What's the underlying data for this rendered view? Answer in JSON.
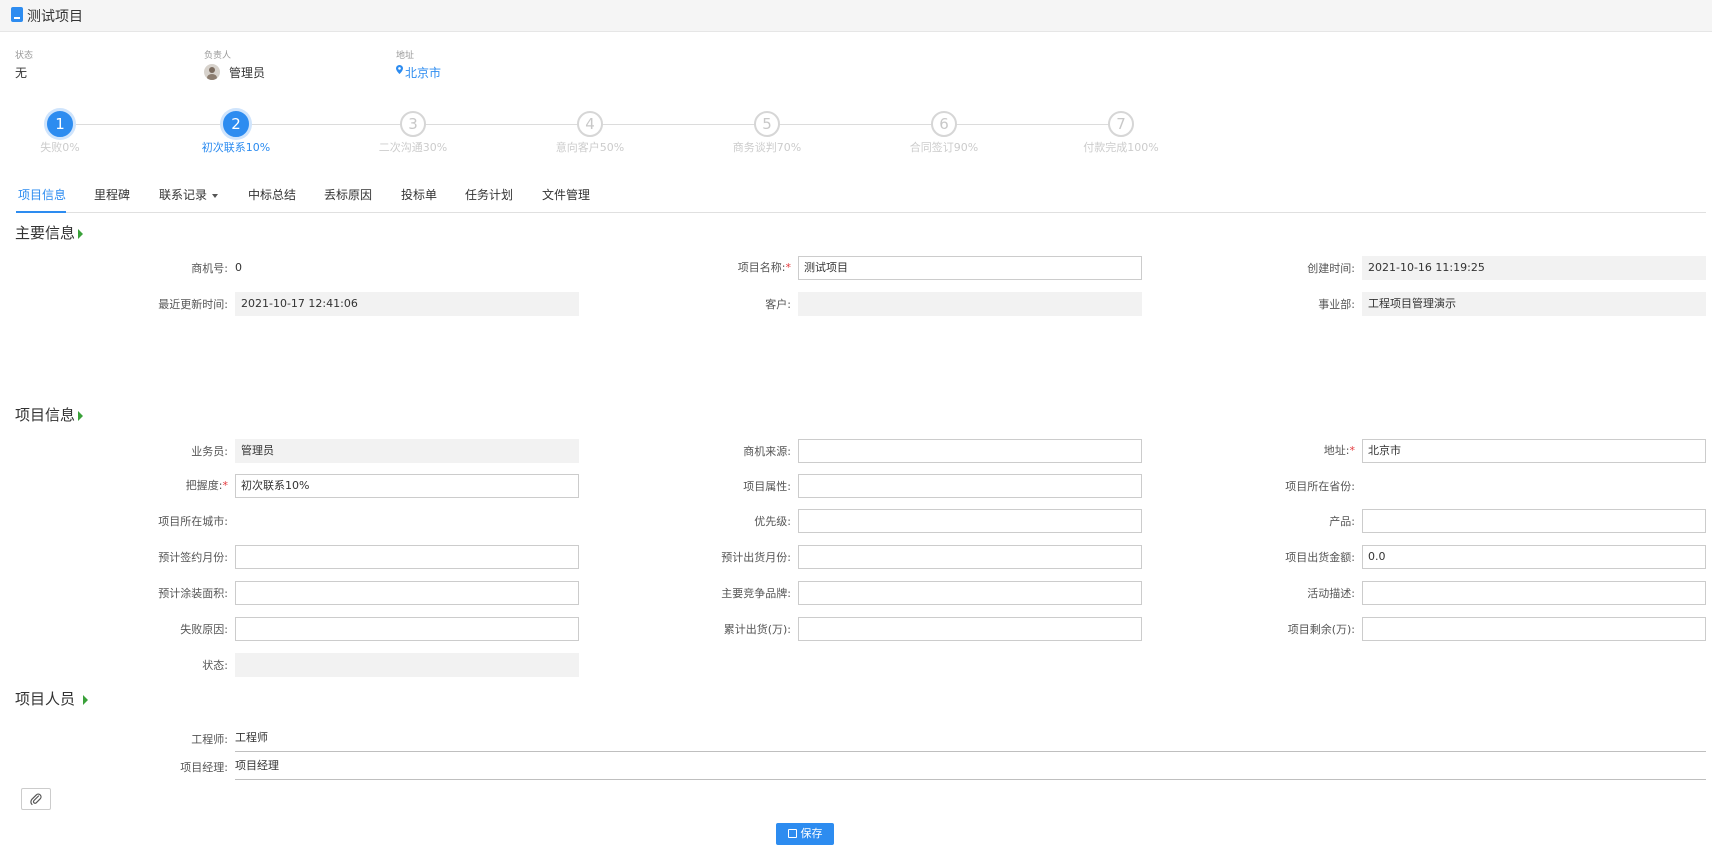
{
  "header": {
    "title": "测试项目",
    "icon": "document-icon"
  },
  "info": {
    "status_label": "状态",
    "status_value": "无",
    "owner_label": "负责人",
    "owner_value": "管理员",
    "address_label": "地址",
    "address_value": "北京市"
  },
  "steps": [
    {
      "num": "1",
      "label": "失败0%",
      "state": "done"
    },
    {
      "num": "2",
      "label": "初次联系10%",
      "state": "current"
    },
    {
      "num": "3",
      "label": "二次沟通30%",
      "state": "todo"
    },
    {
      "num": "4",
      "label": "意向客户50%",
      "state": "todo"
    },
    {
      "num": "5",
      "label": "商务谈判70%",
      "state": "todo"
    },
    {
      "num": "6",
      "label": "合同签订90%",
      "state": "todo"
    },
    {
      "num": "7",
      "label": "付款完成100%",
      "state": "todo"
    }
  ],
  "tabs": [
    "项目信息",
    "里程碑",
    "联系记录",
    "中标总结",
    "丢标原因",
    "投标单",
    "任务计划",
    "文件管理"
  ],
  "main_section": {
    "title": "主要信息",
    "fields": {
      "opp_no_label": "商机号:",
      "opp_no_value": "0",
      "project_name_label": "项目名称:",
      "project_name_value": "测试项目",
      "created_label": "创建时间:",
      "created_value": "2021-10-16 11:19:25",
      "updated_label": "最近更新时间:",
      "updated_value": "2021-10-17 12:41:06",
      "customer_label": "客户:",
      "customer_value": "",
      "division_label": "事业部:",
      "division_value": "工程项目管理演示"
    }
  },
  "project_section": {
    "title": "项目信息",
    "fields": {
      "salesman_label": "业务员:",
      "salesman_value": "管理员",
      "source_label": "商机来源:",
      "source_value": "",
      "address_label": "地址:",
      "address_value": "北京市",
      "grasp_label": "把握度:",
      "grasp_value": "初次联系10%",
      "attribute_label": "项目属性:",
      "attribute_value": "",
      "province_label": "项目所在省份:",
      "city_label": "项目所在城市:",
      "priority_label": "优先级:",
      "priority_value": "",
      "product_label": "产品:",
      "product_value": "",
      "sign_month_label": "预计签约月份:",
      "sign_month_value": "",
      "ship_month_label": "预计出货月份:",
      "ship_month_value": "",
      "ship_amount_label": "项目出货金额:",
      "ship_amount_value": "0.0",
      "paint_area_label": "预计涂装面积:",
      "paint_area_value": "",
      "competitor_label": "主要竞争品牌:",
      "competitor_value": "",
      "activity_label": "活动描述:",
      "activity_value": "",
      "fail_reason_label": "失败原因:",
      "fail_reason_value": "",
      "cum_ship_label": "累计出货(万):",
      "cum_ship_value": "",
      "remaining_label": "项目剩余(万):",
      "remaining_value": "",
      "state_label": "状态:",
      "state_value": ""
    }
  },
  "people_section": {
    "title": "项目人员",
    "engineer_label": "工程师:",
    "engineer_value": "工程师",
    "manager_label": "项目经理:",
    "manager_value": "项目经理"
  },
  "footer": {
    "attach_icon": "paperclip-icon",
    "save_label": "保存",
    "save_icon": "floppy-icon"
  },
  "colors": {
    "accent": "#2d8cf0",
    "section_arrow": "#3aa13a",
    "required": "#e4393c"
  }
}
